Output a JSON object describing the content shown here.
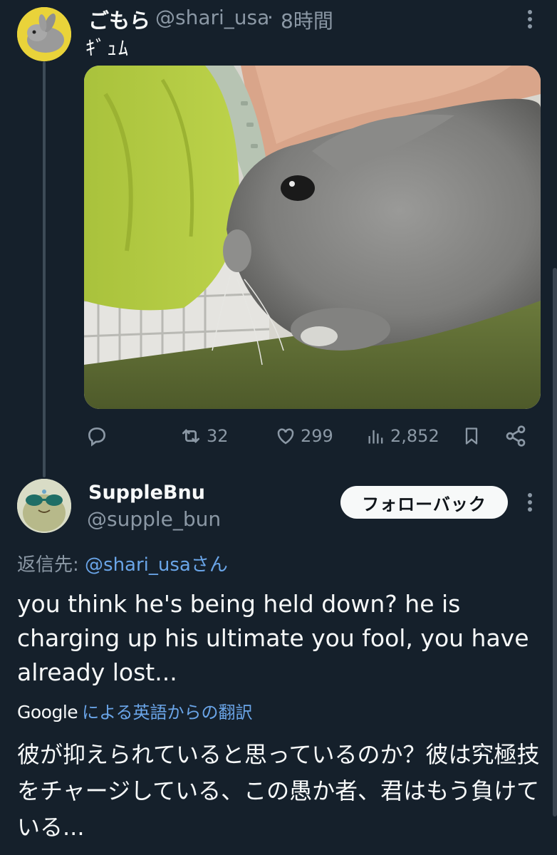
{
  "tweet1": {
    "display_name": "ごもら",
    "handle": "@shari_usa",
    "separator": "·",
    "time": "8時間",
    "text": "ｷﾞｭﾑ",
    "actions": {
      "reply_icon": "reply-icon",
      "retweet_count": "32",
      "like_count": "299",
      "view_count": "2,852",
      "bookmark_icon": "bookmark-icon",
      "share_icon": "share-icon"
    }
  },
  "tweet2": {
    "display_name": "SuppleBnu",
    "handle": "@supple_bun",
    "follow_button": "フォローバック",
    "reply_prefix": "返信先: ",
    "reply_mention": "@shari_usaさん",
    "text": "you think he's being held down? he is charging up his ultimate you fool, you have already lost...",
    "translate_brand": "Google",
    "translate_label": "による英語からの翻訳",
    "translated_text": "彼が抑えられていると思っているのか？彼は究極技をチャージしている、この愚か者、君はもう負けている..."
  },
  "colors": {
    "background": "#15202b",
    "primary_text": "#f7f9f9",
    "secondary_text": "#8b98a5",
    "link": "#6aa5e8"
  }
}
